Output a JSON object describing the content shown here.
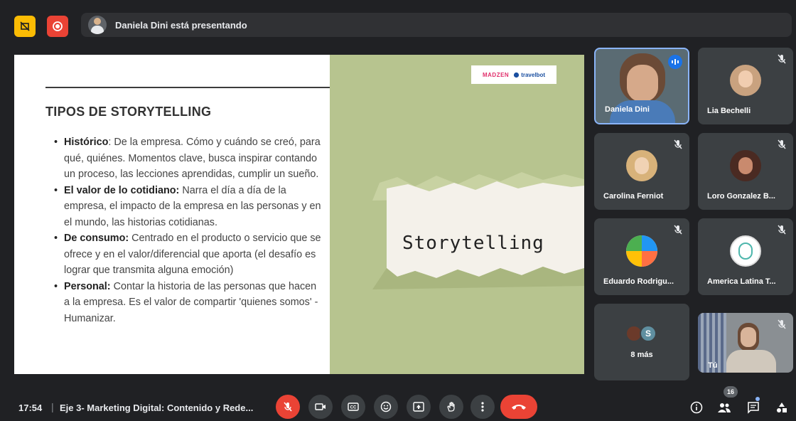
{
  "topbar": {
    "presenter_text": "Daniela Dini está presentando",
    "pin_icon": "pin-off-icon",
    "record_icon": "record-icon",
    "pin_color": "#fbbc04",
    "record_color": "#ea4335"
  },
  "slide": {
    "title": "TIPOS DE STORYTELLING",
    "bullets": [
      {
        "bold": "Histórico",
        "text": ": De la empresa. Cómo y cuándo se creó, para qué, quiénes. Momentos clave, busca inspirar contando un proceso, las lecciones aprendidas, cumplir un sueño."
      },
      {
        "bold": "El valor de lo cotidiano:",
        "text": " Narra el día a día de la empresa, el impacto de la empresa en las personas y en el mundo, las historias cotidianas."
      },
      {
        "bold": "De consumo:",
        "text": " Centrado en el producto o servicio que se ofrece y en el valor/diferencial que aporta (el desafío es lograr que transmita alguna emoción)"
      },
      {
        "bold": "Personal:",
        "text": " Contar la historia de las personas que hacen a la empresa. Es el valor de compartir 'quienes somos' - Humanizar."
      }
    ],
    "image_word": "Storytelling",
    "logo_left": "MADZEN",
    "logo_right": "travelbot"
  },
  "participants": [
    {
      "name": "Daniela Dini",
      "speaking": true
    },
    {
      "name": "Lia Bechelli",
      "muted": true
    },
    {
      "name": "Carolina Ferniot",
      "muted": true
    },
    {
      "name": "Loro Gonzalez B...",
      "muted": true
    },
    {
      "name": "Eduardo Rodrigu...",
      "muted": true
    },
    {
      "name": "America Latina T...",
      "muted": true
    },
    {
      "name": "8 más",
      "avatar_letter": "S"
    },
    {
      "name": "Tú",
      "muted": true
    }
  ],
  "bottombar": {
    "time": "17:54",
    "separator": "|",
    "meeting_title": "Eje 3- Marketing Digital: Contenido y Rede...",
    "people_count": "16",
    "hangup_color": "#ea4335",
    "controls": [
      "mic-off-icon",
      "camera-icon",
      "captions-icon",
      "emoji-icon",
      "present-icon",
      "raise-hand-icon",
      "more-vert-icon",
      "hangup-icon"
    ],
    "right_controls": [
      "info-icon",
      "people-icon",
      "chat-icon",
      "activities-icon"
    ]
  }
}
